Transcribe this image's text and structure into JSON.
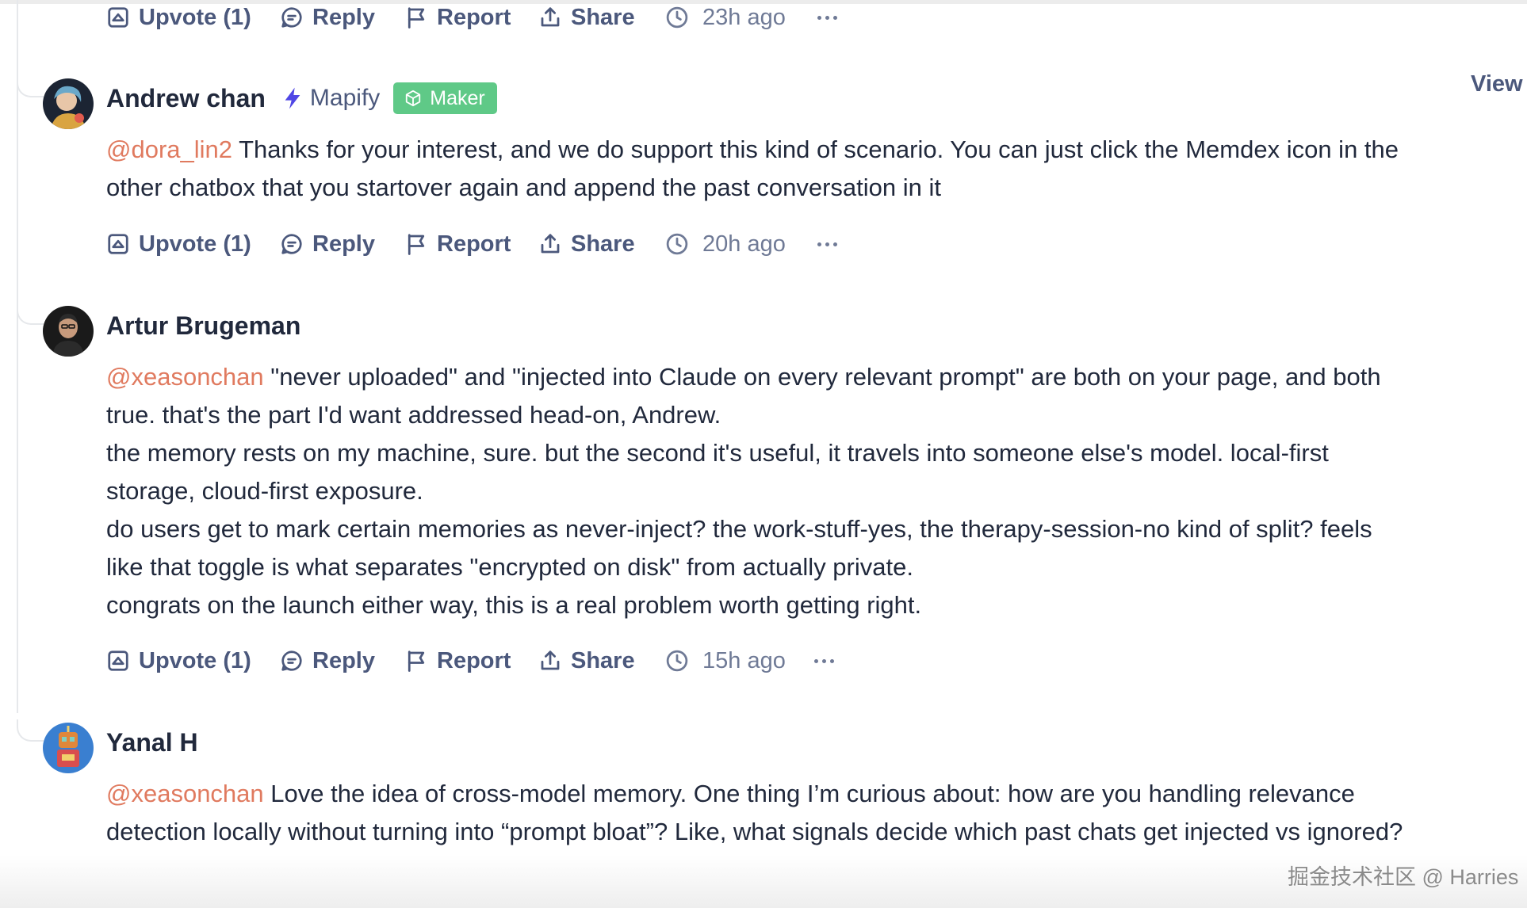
{
  "actions_labels": {
    "upvote": "Upvote (1)",
    "reply": "Reply",
    "report": "Report",
    "share": "Share"
  },
  "top_actions": {
    "time": "23h ago"
  },
  "view_label": "View",
  "comments": [
    {
      "author": "Andrew chan",
      "product": "Mapify",
      "badge": "Maker",
      "mention": "@dora_lin2",
      "paragraphs": [
        " Thanks for your interest, and we do support this kind of scenario. You can just click the Memdex icon in the other chatbox that you startover again and append the past conversation in it"
      ],
      "time": "20h ago",
      "avatar_colors": [
        "#1c2433",
        "#6aa8c9",
        "#d9a441"
      ]
    },
    {
      "author": "Artur Brugeman",
      "mention": "@xeasonchan",
      "paragraphs": [
        " \"never uploaded\" and \"injected into Claude on every relevant prompt\" are both on your page, and both true. that's the part I'd want addressed head-on, Andrew.",
        "the memory rests on my machine, sure. but the second it's useful, it travels into someone else's model. local-first storage, cloud-first exposure.",
        "do users get to mark certain memories as never-inject? the work-stuff-yes, the therapy-session-no kind of split? feels like that toggle is what separates \"encrypted on disk\" from actually private.",
        "congrats on the launch either way, this is a real problem worth getting right."
      ],
      "time": "15h ago",
      "avatar_colors": [
        "#1a1a1a",
        "#c79a7c",
        "#2b2b2b"
      ]
    },
    {
      "author": "Yanal H",
      "mention": "@xeasonchan",
      "paragraphs": [
        " Love the idea of cross-model memory. One thing I’m curious about: how are you handling relevance detection locally without turning into “prompt bloat”? Like, what signals decide which past chats get injected vs ignored?"
      ],
      "avatar_colors": [
        "#3a7fd0",
        "#e0873a",
        "#7fd0c2"
      ]
    }
  ],
  "colors": {
    "mention": "#e07a5f",
    "maker_badge": "#5fc987",
    "action_text": "#4b587c",
    "time_text": "#6f7a96",
    "body_text": "#21293c",
    "product_icon": "#4f46e5"
  },
  "icons": {
    "upvote": "upvote-icon",
    "reply": "reply-icon",
    "report": "flag-icon",
    "share": "share-icon",
    "time": "clock-icon",
    "more": "more-dots-icon",
    "product": "lightning-icon",
    "maker": "cube-icon"
  },
  "watermark": "掘金技术社区 @ Harries"
}
